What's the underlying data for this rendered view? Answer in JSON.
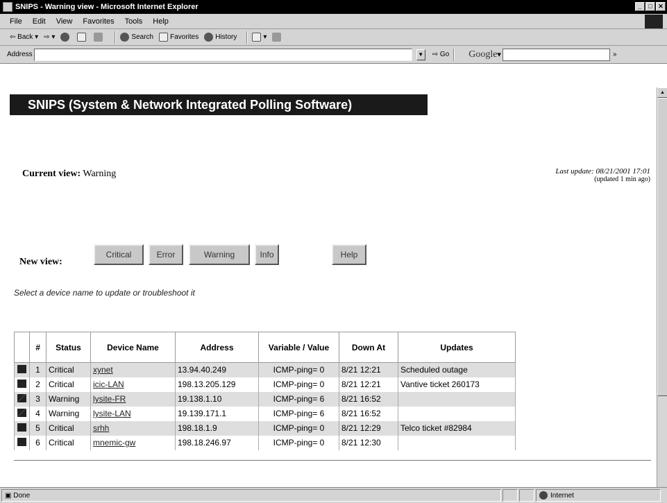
{
  "window": {
    "title": "SNIPS - Warning view - Microsoft Internet Explorer",
    "controls": [
      "_",
      "□",
      "✕"
    ]
  },
  "menu": [
    "File",
    "Edit",
    "View",
    "Favorites",
    "Tools",
    "Help"
  ],
  "toolbar": {
    "back": "Back",
    "search": "Search",
    "favorites": "Favorites",
    "history": "History"
  },
  "address": {
    "label": "Address",
    "value": "",
    "go": "Go",
    "google": "Google",
    "more": "»"
  },
  "page": {
    "banner": "SNIPS (System & Network Integrated Polling Software)",
    "current_view_label": "Current view:",
    "current_view_value": "Warning",
    "last_update": "Last update: 08/21/2001 17:01",
    "updated_ago": "(updated 1 min ago)",
    "new_view_label": "New view:",
    "buttons": {
      "critical": "Critical",
      "error": "Error",
      "warning": "Warning",
      "info": "Info",
      "help": "Help"
    },
    "hint": "Select a device name to update or troubleshoot it"
  },
  "table": {
    "headers": {
      "num": "#",
      "status": "Status",
      "device": "Device Name",
      "address": "Address",
      "variable": "Variable / Value",
      "down_at": "Down At",
      "updates": "Updates"
    },
    "rows": [
      {
        "num": "1",
        "status": "Critical",
        "device": "xynet",
        "address": "13.94.40.249",
        "variable": "ICMP-ping= 0",
        "down_at": "8/21 12:21",
        "updates": "Scheduled outage",
        "flag": "critical"
      },
      {
        "num": "2",
        "status": "Critical",
        "device": "icic-LAN",
        "address": "198.13.205.129",
        "variable": "ICMP-ping= 0",
        "down_at": "8/21 12:21",
        "updates": "Vantive ticket 260173",
        "flag": "critical"
      },
      {
        "num": "3",
        "status": "Warning",
        "device": "lysite-FR",
        "address": "19.138.1.10",
        "variable": "ICMP-ping= 6",
        "down_at": "8/21 16:52",
        "updates": "",
        "flag": "warning"
      },
      {
        "num": "4",
        "status": "Warning",
        "device": "lysite-LAN",
        "address": "19.139.171.1",
        "variable": "ICMP-ping= 6",
        "down_at": "8/21 16:52",
        "updates": "",
        "flag": "warning"
      },
      {
        "num": "5",
        "status": "Critical",
        "device": "srhh",
        "address": "198.18.1.9",
        "variable": "ICMP-ping= 0",
        "down_at": "8/21 12:29",
        "updates": "Telco ticket #82984",
        "flag": "critical"
      },
      {
        "num": "6",
        "status": "Critical",
        "device": "mnemic-gw",
        "address": "198.18.246.97",
        "variable": "ICMP-ping= 0",
        "down_at": "8/21 12:30",
        "updates": "",
        "flag": "critical"
      }
    ]
  },
  "status": {
    "text": "Done",
    "zone": "Internet"
  }
}
